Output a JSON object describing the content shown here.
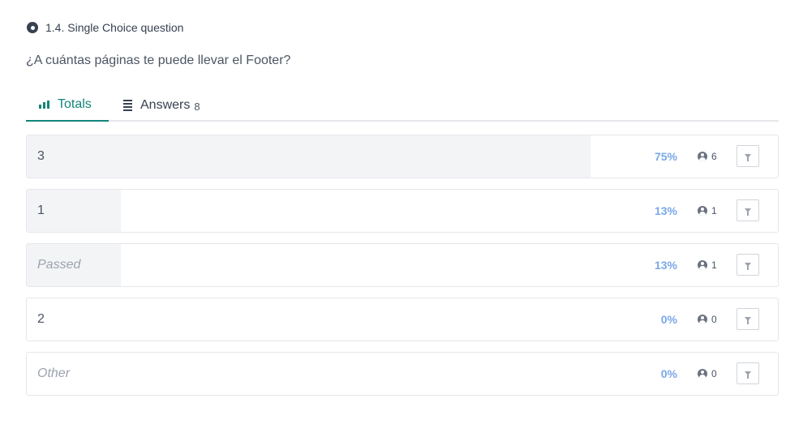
{
  "question": {
    "number_title": "1.4. Single Choice question",
    "text": "¿A cuántas páginas te puede llevar el Footer?"
  },
  "tabs": [
    {
      "label": "Totals",
      "icon": "bar-chart-icon",
      "active": true
    },
    {
      "label": "Answers",
      "icon": "list-icon",
      "count": "8",
      "active": false
    }
  ],
  "colors": {
    "accent": "#12857a",
    "percent": "#7aa7e8",
    "bar_fill": "#f3f4f6"
  },
  "rows": [
    {
      "label": "3",
      "percent_text": "75%",
      "fraction": 0.75,
      "count": "6",
      "italic": false
    },
    {
      "label": "1",
      "percent_text": "13%",
      "fraction": 0.125,
      "count": "1",
      "italic": false
    },
    {
      "label": "Passed",
      "percent_text": "13%",
      "fraction": 0.125,
      "count": "1",
      "italic": true
    },
    {
      "label": "2",
      "percent_text": "0%",
      "fraction": 0,
      "count": "0",
      "italic": false
    },
    {
      "label": "Other",
      "percent_text": "0%",
      "fraction": 0,
      "count": "0",
      "italic": true
    }
  ]
}
